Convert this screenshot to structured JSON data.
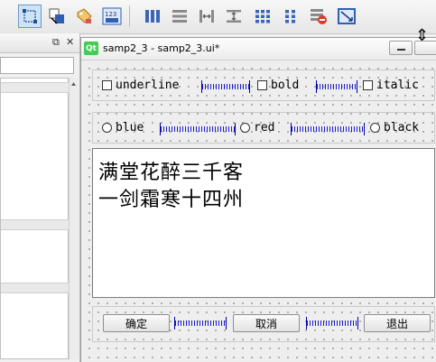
{
  "toolbar": {
    "icons": [
      "edit-widgets-icon",
      "edit-signals-slots-icon",
      "edit-buddies-icon",
      "edit-tab-order-icon",
      "layout-horizontal-icon",
      "layout-vertical-icon",
      "layout-splitter-horizontal-icon",
      "layout-splitter-vertical-icon",
      "layout-grid-icon",
      "layout-form-icon",
      "break-layout-icon",
      "adjust-size-icon"
    ],
    "tab_order_label": "123"
  },
  "left_dock": {
    "float_icon": "float-icon",
    "close_icon": "close-icon"
  },
  "form_window": {
    "logo_text": "Qt",
    "title": "samp2_3 - samp2_3.ui*",
    "checkboxes": [
      {
        "label": "underline",
        "checked": false
      },
      {
        "label": "bold",
        "checked": false
      },
      {
        "label": "italic",
        "checked": false
      }
    ],
    "radios": [
      {
        "label": "blue",
        "checked": false
      },
      {
        "label": "red",
        "checked": false
      },
      {
        "label": "black",
        "checked": false
      }
    ],
    "text_lines": [
      "满堂花醉三千客",
      "一剑霜寒十四州"
    ],
    "buttons": {
      "ok": "确定",
      "cancel": "取消",
      "exit": "退出"
    }
  }
}
